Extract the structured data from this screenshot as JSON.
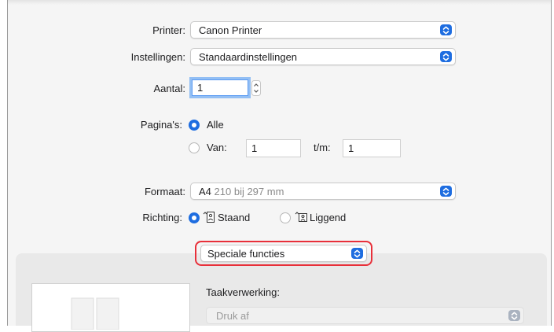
{
  "printer": {
    "label": "Printer:",
    "value": "Canon Printer"
  },
  "presets": {
    "label": "Instellingen:",
    "value": "Standaardinstellingen"
  },
  "copies": {
    "label": "Aantal:",
    "value": "1"
  },
  "pages": {
    "label": "Pagina's:",
    "all_label": "Alle",
    "from_label": "Van:",
    "from_value": "1",
    "to_label": "t/m:",
    "to_value": "1",
    "selected": "all"
  },
  "paper_size": {
    "label": "Formaat:",
    "value": "A4",
    "detail": "210 bij 297 mm"
  },
  "orientation": {
    "label": "Richting:",
    "portrait_label": "Staand",
    "landscape_label": "Liggend",
    "selected": "portrait"
  },
  "section_menu": {
    "value": "Speciale functies"
  },
  "job_processing": {
    "label": "Taakverwerking:",
    "value": "Druk af"
  },
  "colors": {
    "accent": "#1e6de0",
    "highlight": "#e8303a"
  }
}
